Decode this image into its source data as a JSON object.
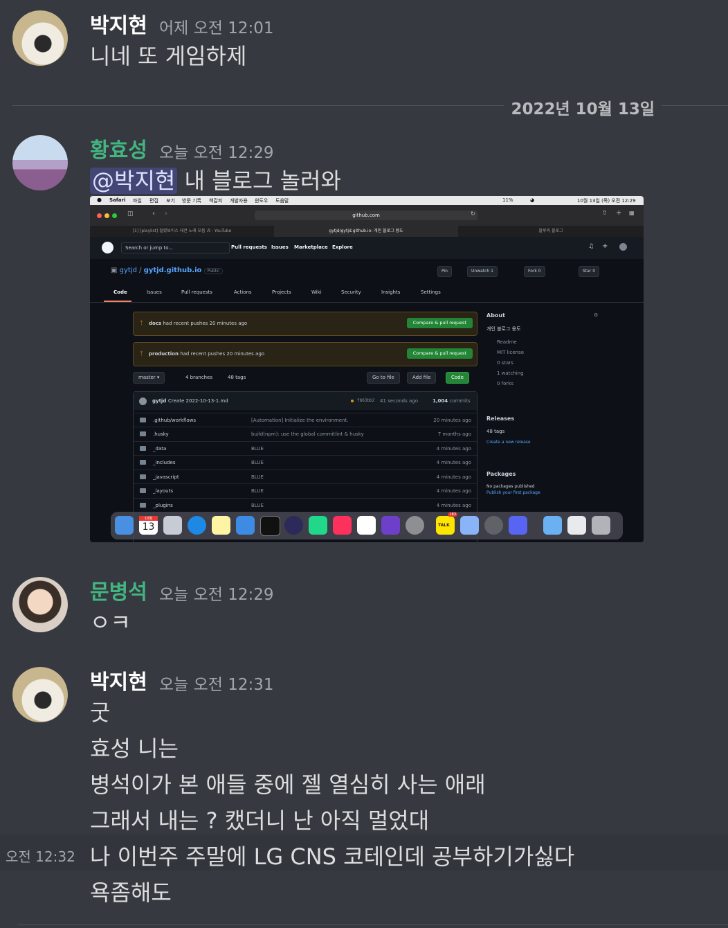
{
  "messages": [
    {
      "author": "박지현",
      "author_color": "#ffffff",
      "time": "어제 오전 12:01",
      "lines": [
        "니네 또 게임하제"
      ]
    },
    {
      "author": "황효성",
      "author_color": "#43b581",
      "time": "오늘 오전 12:29",
      "mention": "@박지현",
      "line": "내 블로그 놀러와"
    },
    {
      "author": "문병석",
      "author_color": "#43b581",
      "time": "오늘 오전 12:29",
      "lines": [
        "ㅇㅋ"
      ]
    },
    {
      "author": "박지현",
      "author_color": "#ffffff",
      "time": "오늘 오전 12:31",
      "lines": [
        "굿",
        "효성 니는",
        "병석이가 본 애들 중에 젤 열심히 사는 애래",
        "그래서 내는 ? 캤더니 난 아직 멀었대",
        "나 이번주 주말에 LG CNS 코테인데 공부하기가싫다",
        "욕좀해도"
      ]
    }
  ],
  "hover_time": "오전 12:32",
  "divider_date": "2022년 10월 13일",
  "screenshot": {
    "menubar": {
      "apple": "",
      "items": [
        "Safari",
        "파일",
        "편집",
        "보기",
        "방문 기록",
        "책갈피",
        "개발자용",
        "윈도우",
        "도움말"
      ],
      "battery": "11%",
      "clock": "10월 13일 (목) 오전 12:29"
    },
    "url": "github.com",
    "tabs": [
      "[1] [playlist] 질렸보이스 대전 노래 모음 ♬ - YouTube",
      "gytjd/gytjd.github.io: 개인 블로그 용도",
      "블루의 블로그"
    ],
    "gh_search": "Search or jump to...",
    "gh_nav": [
      "Pull requests",
      "Issues",
      "Marketplace",
      "Explore"
    ],
    "repo_owner": "gytjd",
    "repo_name": "gytjd.github.io",
    "repo_visibility": "Public",
    "repo_buttons": {
      "pin": "Pin",
      "unwatch": "Unwatch",
      "unwatch_count": "1",
      "fork": "Fork",
      "fork_count": "0",
      "star": "Star",
      "star_count": "0"
    },
    "repo_tabs": [
      "Code",
      "Issues",
      "Pull requests",
      "Actions",
      "Projects",
      "Wiki",
      "Security",
      "Insights",
      "Settings"
    ],
    "pushes": [
      {
        "branch": "docs",
        "text": "had recent pushes 20 minutes ago",
        "button": "Compare & pull request"
      },
      {
        "branch": "production",
        "text": "had recent pushes 20 minutes ago",
        "button": "Compare & pull request"
      }
    ],
    "branch": "master",
    "branches": "4 branches",
    "tags": "48 tags",
    "go_to_file": "Go to file",
    "add_file": "Add file",
    "code_btn": "Code",
    "commit": {
      "user": "gytjd",
      "message": "Create 2022-10-13-1.md",
      "hash": "f863bb2",
      "ago": "41 seconds ago",
      "count": "1,004",
      "count_label": "commits"
    },
    "files": [
      {
        "name": ".github/workflows",
        "msg": "[Automation] Initialize the environment.",
        "time": "20 minutes ago"
      },
      {
        "name": ".husky",
        "msg": "build(npm): use the global commitlint & husky",
        "time": "7 months ago"
      },
      {
        "name": "_data",
        "msg": "BLUE",
        "time": "4 minutes ago"
      },
      {
        "name": "_includes",
        "msg": "BLUE",
        "time": "4 minutes ago"
      },
      {
        "name": "_javascript",
        "msg": "BLUE",
        "time": "4 minutes ago"
      },
      {
        "name": "_layouts",
        "msg": "BLUE",
        "time": "4 minutes ago"
      },
      {
        "name": "_plugins",
        "msg": "BLUE",
        "time": "4 minutes ago"
      }
    ],
    "about": {
      "title": "About",
      "desc": "개인 블로그 용도",
      "items": [
        "Readme",
        "MIT license",
        "0 stars",
        "1 watching",
        "0 forks"
      ],
      "releases_title": "Releases",
      "releases_tags": "48 tags",
      "releases_link": "Create a new release",
      "packages_title": "Packages",
      "packages_none": "No packages published",
      "packages_link": "Publish your first package"
    },
    "dock": {
      "calendar_month": "10월",
      "calendar_day": "13",
      "badge_talk": "183",
      "talk_label": "TALK"
    }
  }
}
